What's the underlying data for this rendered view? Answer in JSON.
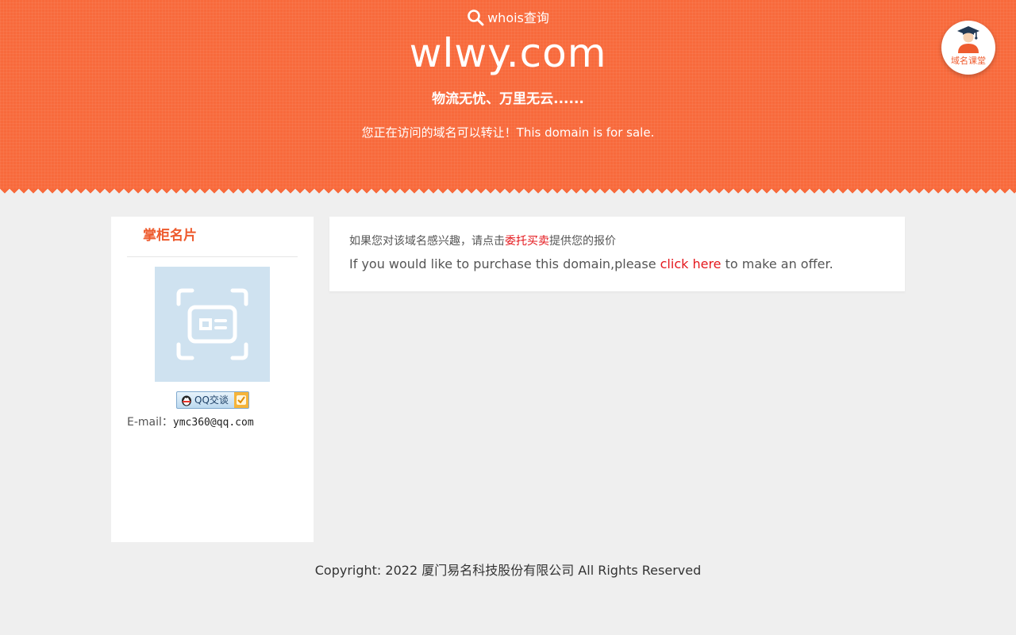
{
  "header": {
    "whois_label": "whois查询",
    "domain": "wlwy.com",
    "slogan": "物流无忧、万里无云......",
    "sale_notice": "您正在访问的域名可以转让！This domain is for sale."
  },
  "classroom": {
    "label": "域名课堂",
    "icon": "graduate-icon"
  },
  "seller_card": {
    "title": "掌柜名片",
    "qq_button_label": "QQ交谈",
    "email_label": "E-mail：",
    "email_value": "ymc360@qq.com"
  },
  "offer": {
    "cn_prefix": "如果您对该域名感兴趣，请点击",
    "cn_link": "委托买卖",
    "cn_suffix": "提供您的报价",
    "en_prefix": "If you would like to purchase this domain,please ",
    "en_link": "click here",
    "en_suffix": " to make an offer."
  },
  "footer": {
    "copyright": "Copyright: 2022 厦门易名科技股份有限公司 All Rights Reserved"
  },
  "colors": {
    "hero": "#f86a3c",
    "accent": "#ee5b2e",
    "link_red": "#e4171c",
    "background": "#efefef"
  }
}
